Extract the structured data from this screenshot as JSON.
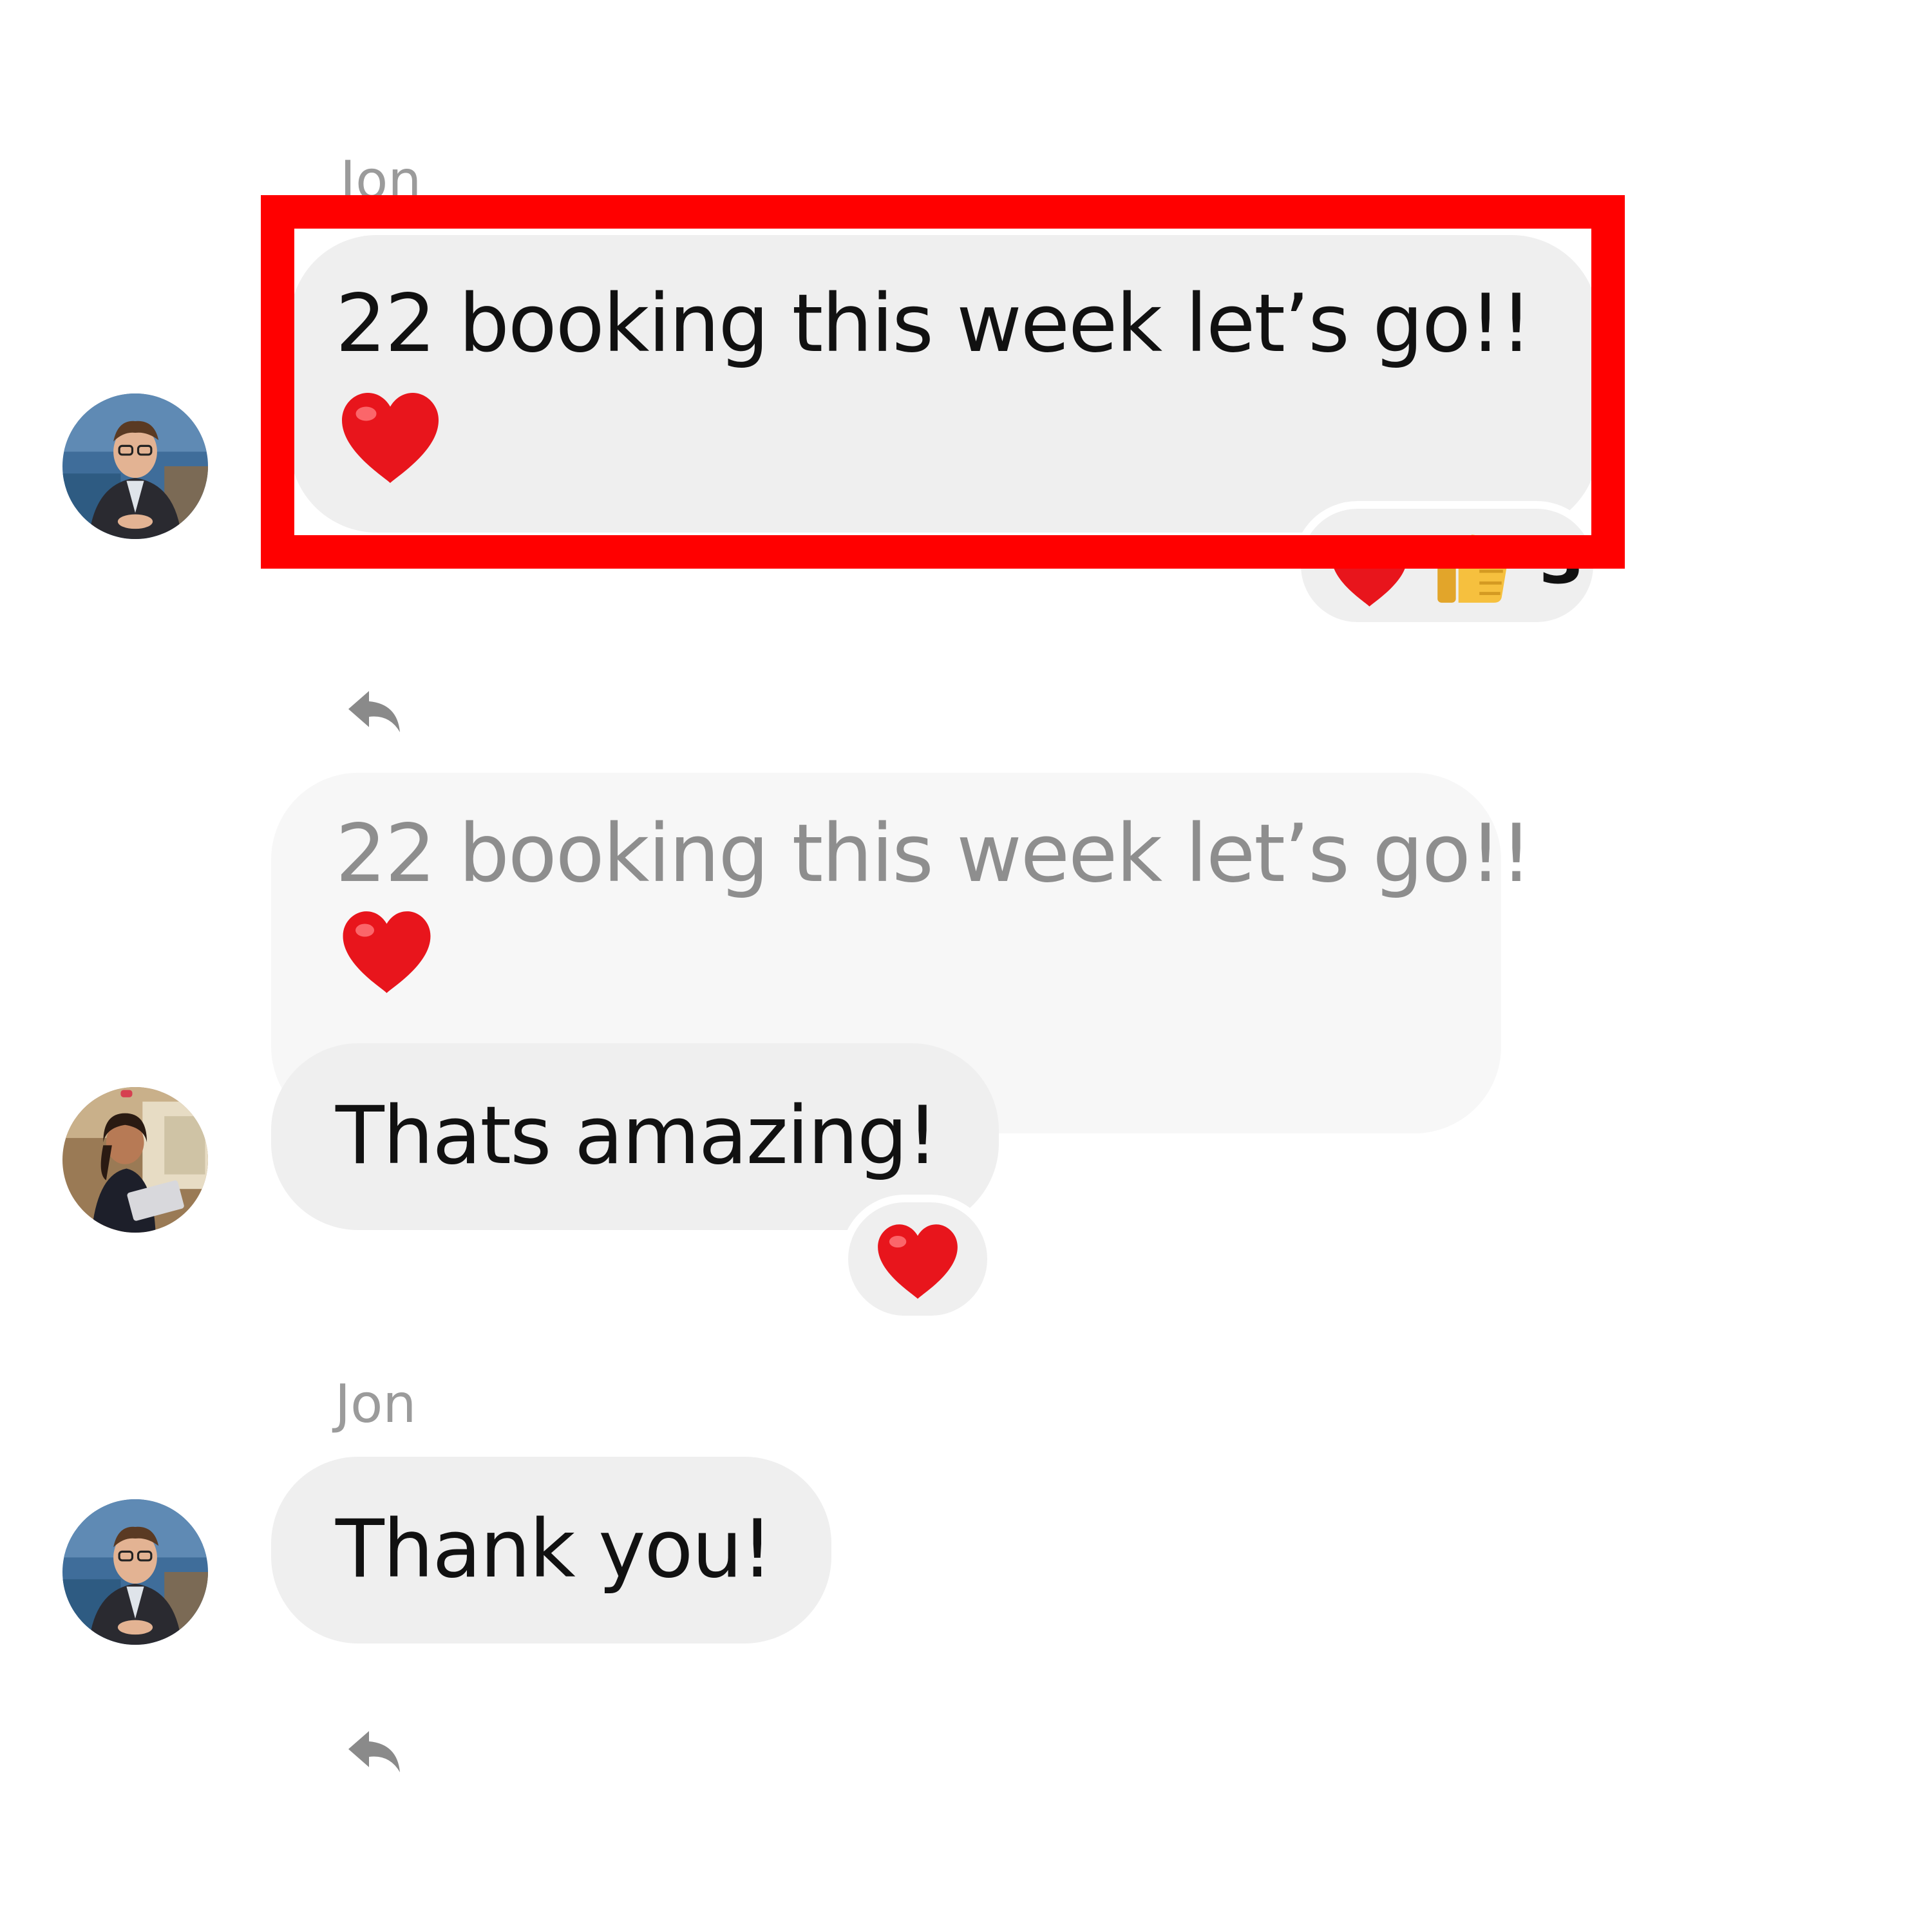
{
  "messages": [
    {
      "sender": "Jon",
      "text": "22 booking this week let’s go!!",
      "emoji": "red-heart",
      "reactions": {
        "emojis": [
          "red-heart",
          "thumbs-up"
        ],
        "count": "3"
      }
    },
    {
      "quoted_text": "22 booking this week let’s go!!",
      "quoted_emoji": "red-heart",
      "text": "Thats amazing!",
      "reaction": "red-heart"
    },
    {
      "sender": "Jon",
      "text": "Thank you!"
    }
  ],
  "colors": {
    "highlight": "#ff0000",
    "bubble": "#efefef",
    "quoted_bubble": "#f7f7f7",
    "sender_text": "#9b9b9b",
    "heart": "#e8151c",
    "thumbs": "#f6c03e"
  }
}
